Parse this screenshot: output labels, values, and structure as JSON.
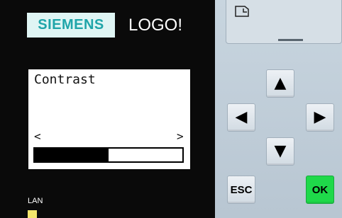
{
  "brand": {
    "logo": "SIEMENS",
    "product": "LOGO!"
  },
  "display": {
    "title": "Contrast",
    "left_arrow": "<",
    "right_arrow": ">",
    "contrast_level": 0.5
  },
  "indicators": {
    "lan_label": "LAN",
    "lan_color": "#f4e66c"
  },
  "buttons": {
    "up": "▲",
    "left": "◀",
    "right": "▶",
    "down": "▼",
    "esc": "ESC",
    "ok": "OK"
  },
  "colors": {
    "ok": "#1fd94a",
    "brand_text": "#1fa5a9"
  }
}
